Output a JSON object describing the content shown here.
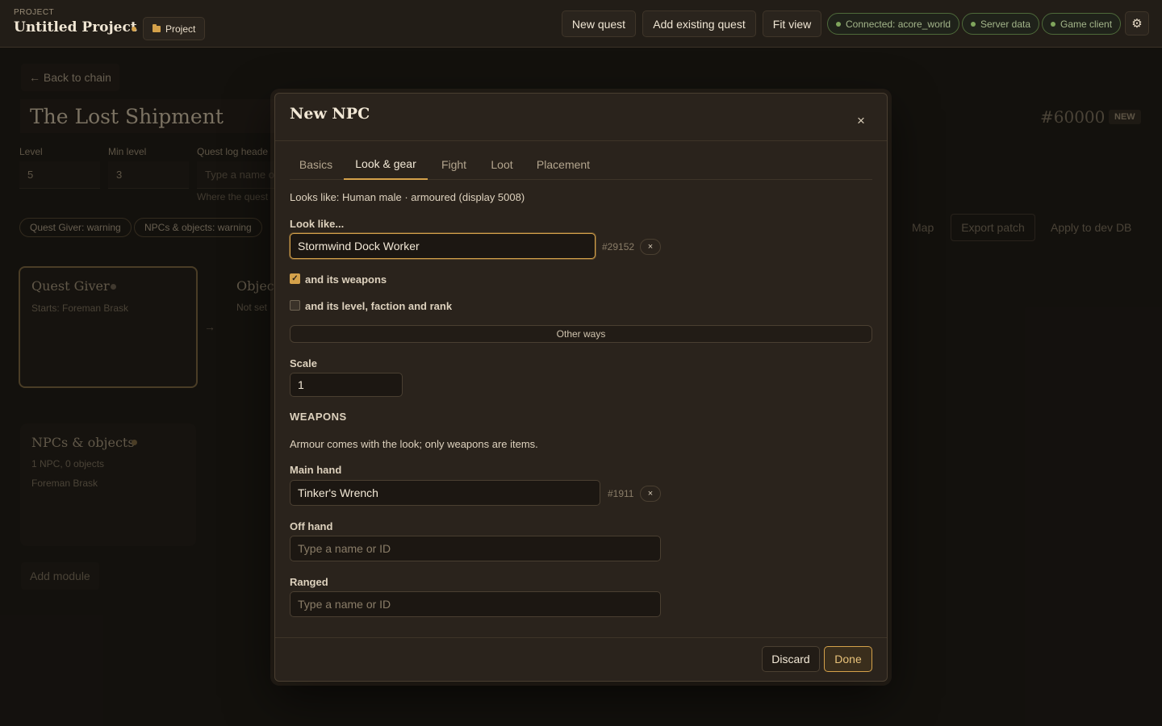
{
  "header": {
    "project_label": "PROJECT",
    "project_title": "Untitled Project",
    "project_button": "Project",
    "new_quest": "New quest",
    "add_existing_quest": "Add existing quest",
    "fit_view": "Fit view",
    "status": {
      "connection": "Connected: acore_world",
      "server_data": "Server data",
      "game_client": "Game client"
    },
    "settings_icon": "gear-icon",
    "accent_color": "#d4a14a",
    "status_color": "#7fa55c"
  },
  "page": {
    "back_label": "← Back to chain",
    "quest_title": "The Lost Shipment",
    "quest_id": "#60000",
    "new_badge": "NEW",
    "fields": {
      "level_label": "Level",
      "level_value": "5",
      "min_level_label": "Min level",
      "min_level_value": "3",
      "quest_log_label": "Quest log heade",
      "quest_log_placeholder": "Type a name o",
      "quest_hint": "Where the quest"
    },
    "warnings": [
      "Quest Giver: warning",
      "NPCs & objects: warning"
    ],
    "actions": {
      "map": "Map",
      "export_patch": "Export patch",
      "apply_dev_db": "Apply to dev DB"
    },
    "cards": {
      "quest_giver_title": "Quest Giver",
      "quest_giver_sub": "Starts: Foreman Brask",
      "objectives_title": "Object",
      "objectives_sub": "Not set",
      "npcs_title": "NPCs & objects",
      "npcs_counts": "1 NPC, 0 objects",
      "npcs_name": "Foreman Brask"
    },
    "arrow": "→",
    "add_module": "Add module"
  },
  "modal": {
    "title": "New NPC",
    "close_symbol": "×",
    "tabs": [
      "Basics",
      "Look & gear",
      "Fight",
      "Loot",
      "Placement"
    ],
    "active_tab": "Look & gear",
    "summary": "Looks like: Human male · armoured (display 5008)",
    "look_like_label": "Look like...",
    "look_like_value": "Stormwind Dock Worker",
    "look_like_id": "#29152",
    "clear_symbol": "×",
    "check_weapons_label": "and its weapons",
    "check_weapons_checked": true,
    "check_level_label": "and its level, faction and rank",
    "check_level_checked": false,
    "check_mark": "✓",
    "other_ways": "Other ways",
    "scale_label": "Scale",
    "scale_value": "1",
    "weapons_heading": "WEAPONS",
    "weapons_note": "Armour comes with the look; only weapons are items.",
    "main_hand_label": "Main hand",
    "main_hand_value": "Tinker's Wrench",
    "main_hand_id": "#1911",
    "off_hand_label": "Off hand",
    "off_hand_placeholder": "Type a name or ID",
    "ranged_label": "Ranged",
    "ranged_placeholder": "Type a name or ID",
    "discard": "Discard",
    "done": "Done"
  }
}
